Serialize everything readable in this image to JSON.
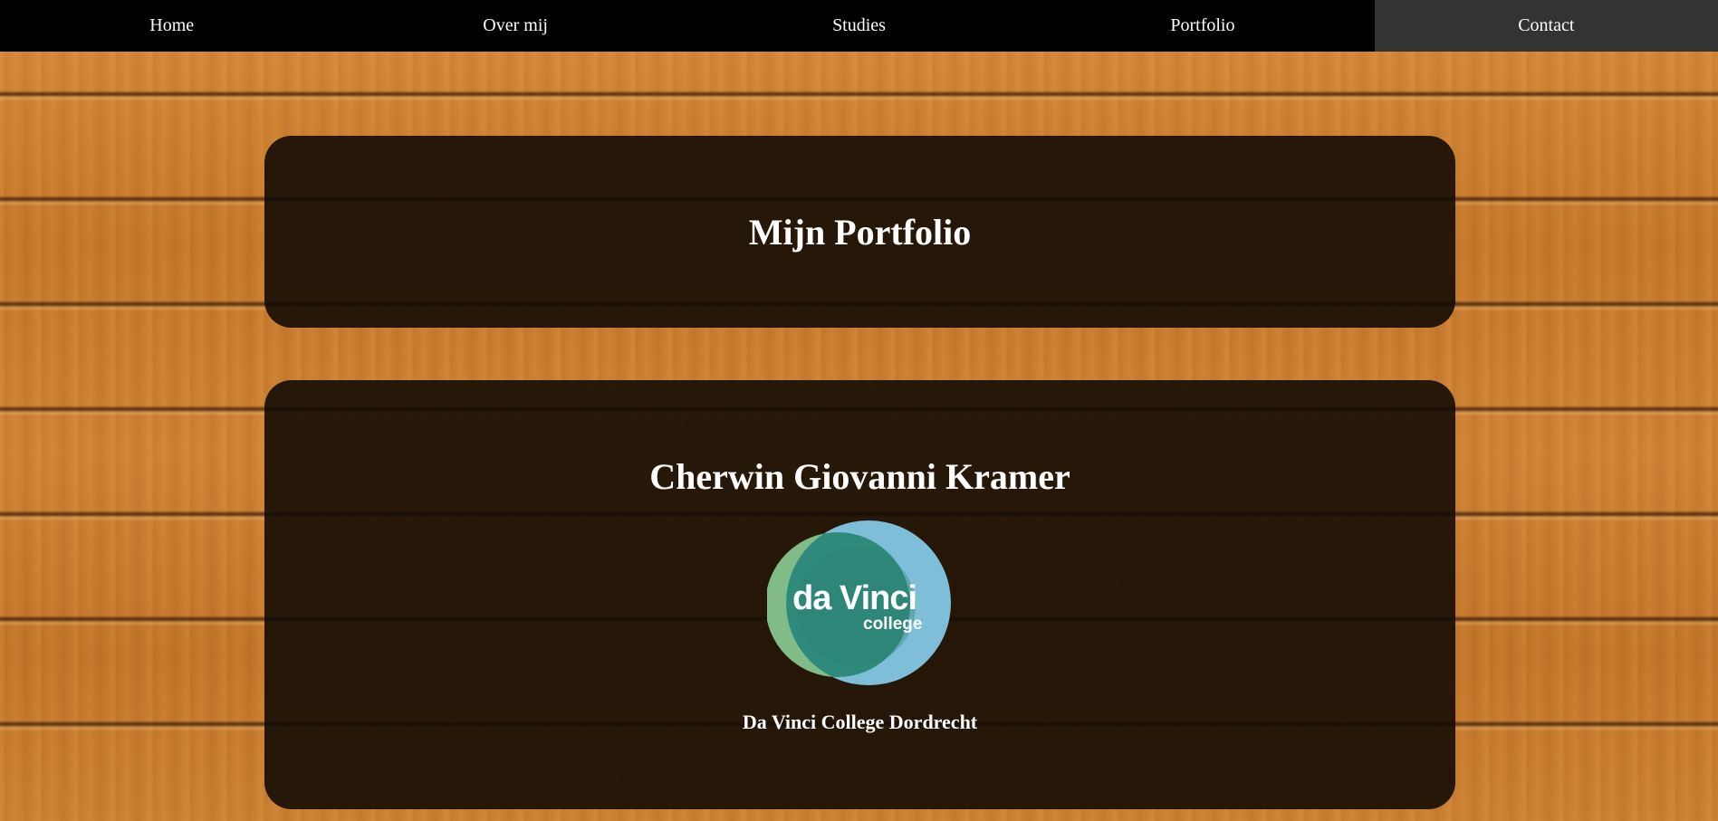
{
  "nav": {
    "items": [
      {
        "label": "Home"
      },
      {
        "label": "Over mij"
      },
      {
        "label": "Studies"
      },
      {
        "label": "Portfolio"
      },
      {
        "label": "Contact"
      }
    ],
    "active": "Contact"
  },
  "header_panel": {
    "title": "Mijn Portfolio"
  },
  "profile_panel": {
    "name": "Cherwin Giovanni Kramer",
    "logo": {
      "line1": "da Vinci",
      "line2": "college",
      "colors": {
        "left_circle": "#7fc08a",
        "right_circle": "#7fc9e8",
        "overlap": "#2e8b7a"
      }
    },
    "caption": "Da Vinci College Dordrecht"
  },
  "colors": {
    "nav_bg": "#000000",
    "nav_active_bg": "#333333",
    "panel_bg": "rgba(20,12,4,0.90)",
    "text": "#ffffff"
  }
}
